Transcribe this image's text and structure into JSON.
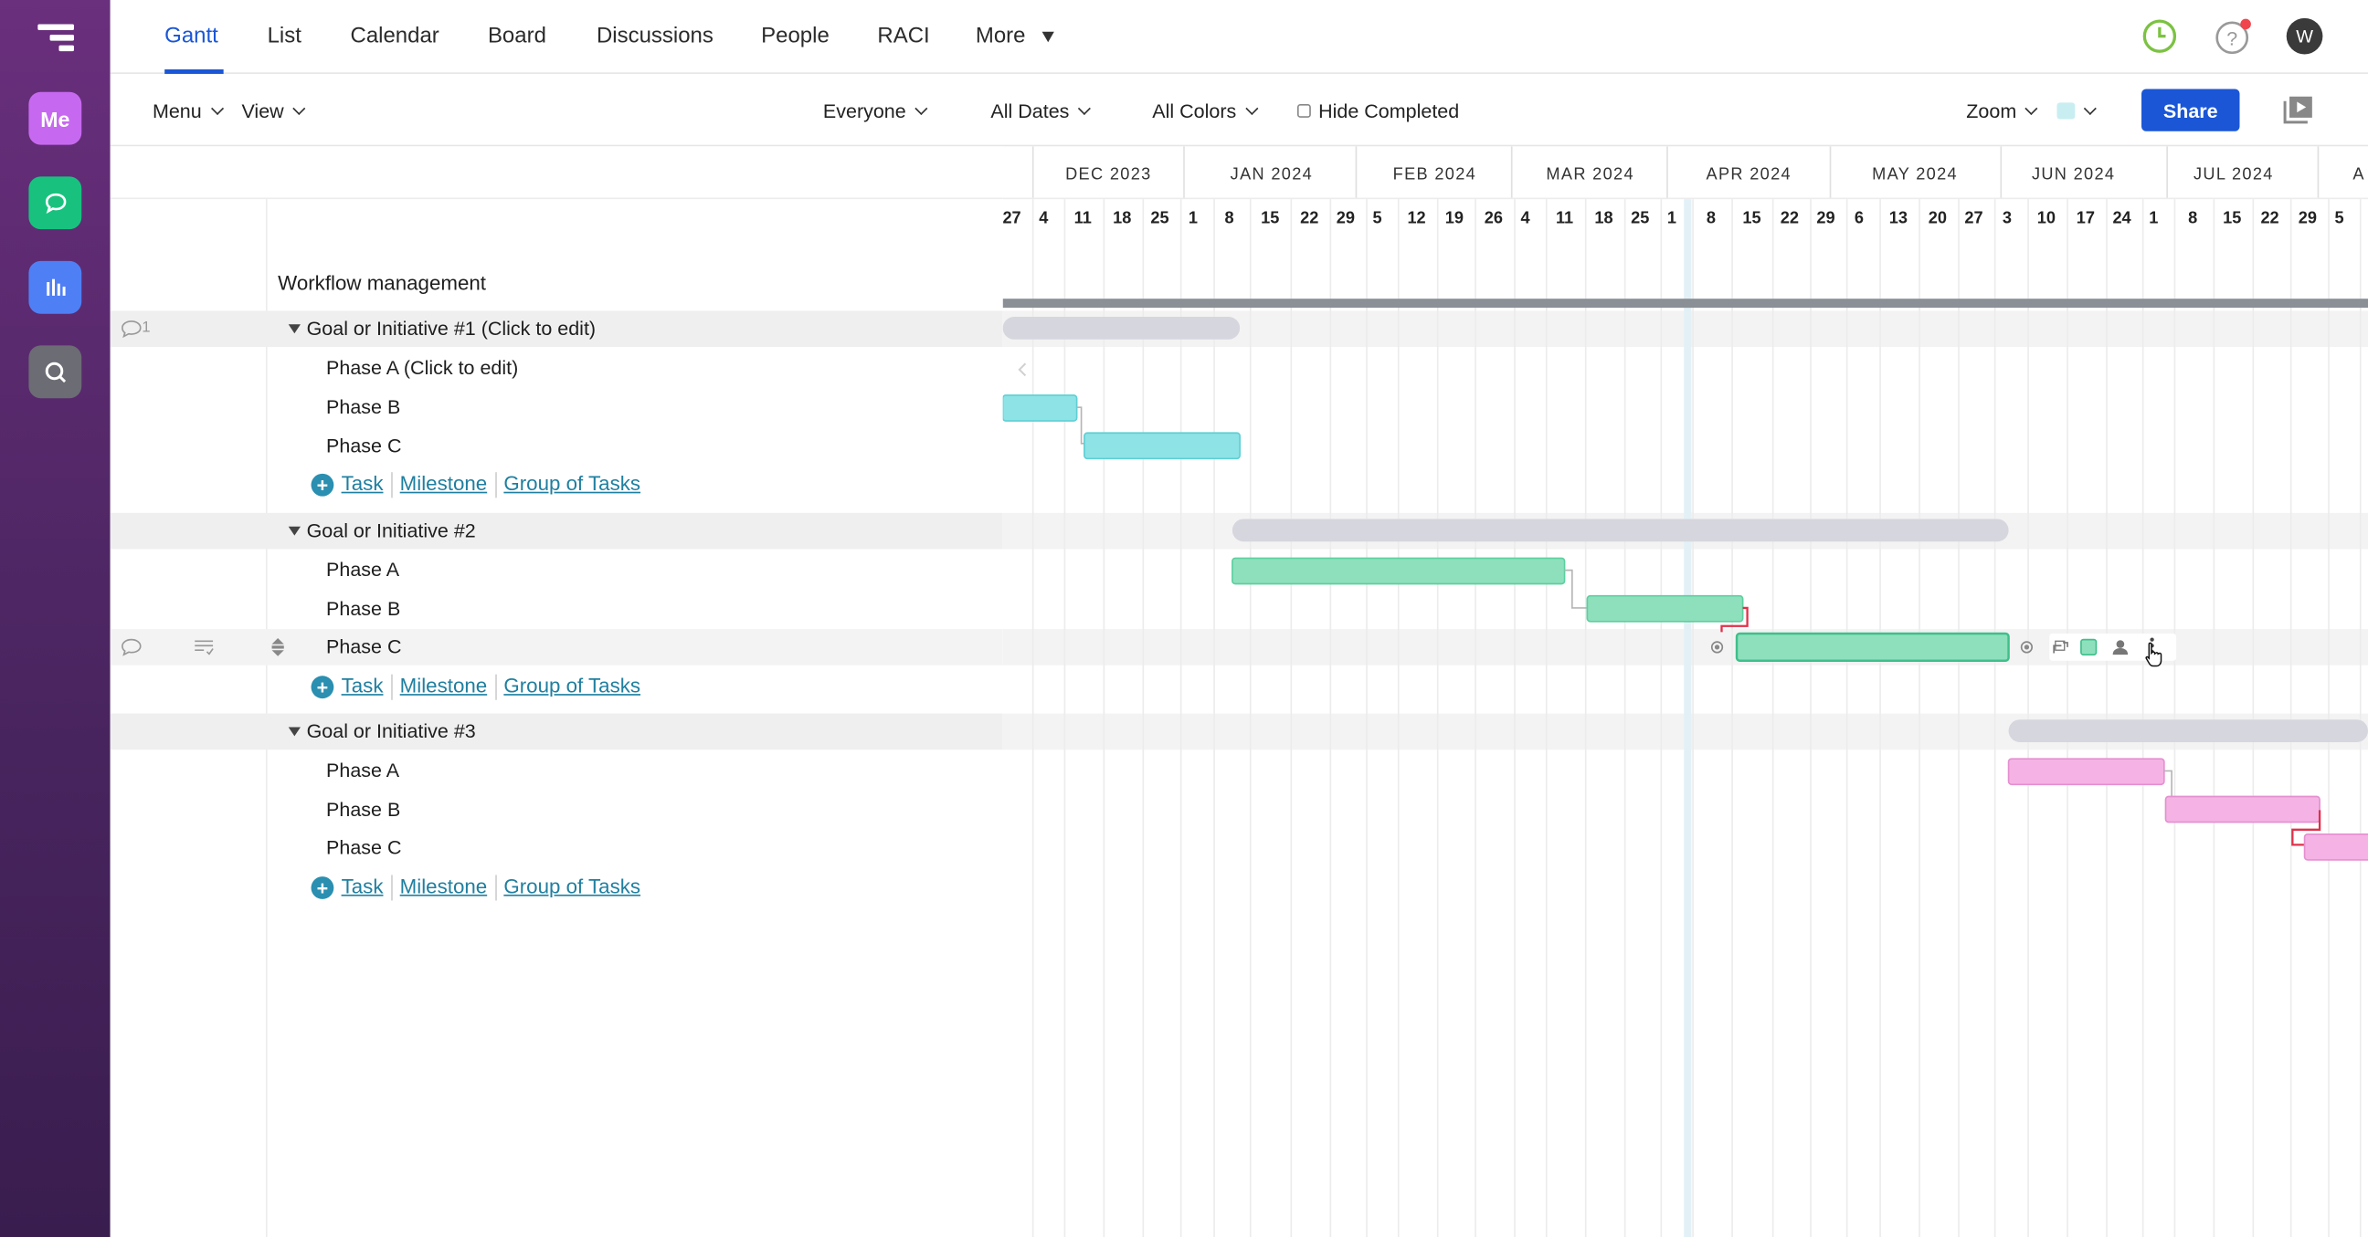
{
  "rail": {
    "me_label": "Me"
  },
  "nav": {
    "tabs": [
      "Gantt",
      "List",
      "Calendar",
      "Board",
      "Discussions",
      "People",
      "RACI",
      "More"
    ],
    "active_tab": "Gantt",
    "avatar_initial": "W"
  },
  "toolbar": {
    "menu": "Menu",
    "view": "View",
    "everyone": "Everyone",
    "all_dates": "All Dates",
    "all_colors": "All Colors",
    "hide_completed": "Hide Completed",
    "zoom": "Zoom",
    "share": "Share"
  },
  "project": {
    "title": "Workflow management",
    "comment_count": "1",
    "groups": [
      {
        "label": "Goal or Initiative #1 (Click to edit)",
        "phases": [
          "Phase A (Click to edit)",
          "Phase B",
          "Phase C"
        ]
      },
      {
        "label": "Goal or Initiative #2",
        "phases": [
          "Phase A",
          "Phase B",
          "Phase C"
        ]
      },
      {
        "label": "Goal or Initiative #3",
        "phases": [
          "Phase A",
          "Phase B",
          "Phase C"
        ]
      }
    ],
    "add_links": {
      "task": "Task",
      "milestone": "Milestone",
      "group": "Group of Tasks"
    }
  },
  "timeline": {
    "months": [
      "DEC 2023",
      "JAN 2024",
      "FEB 2024",
      "MAR 2024",
      "APR 2024",
      "MAY 2024",
      "JUN 2024",
      "JUL 2024",
      "A"
    ],
    "days": [
      "27",
      "4",
      "11",
      "18",
      "25",
      "1",
      "8",
      "15",
      "22",
      "29",
      "5",
      "12",
      "19",
      "26",
      "4",
      "11",
      "18",
      "25",
      "1",
      "8",
      "15",
      "22",
      "29",
      "6",
      "13",
      "20",
      "27",
      "3",
      "10",
      "17",
      "24",
      "1",
      "8",
      "15",
      "22",
      "29",
      "5"
    ]
  },
  "colors": {
    "accent": "#1a56d6",
    "group_bar": "#d6d6de",
    "teal_bar": "#8ee3e6",
    "green_bar": "#8ee0bd",
    "pink_bar": "#f4b3e4",
    "link_red": "#e0304a"
  }
}
